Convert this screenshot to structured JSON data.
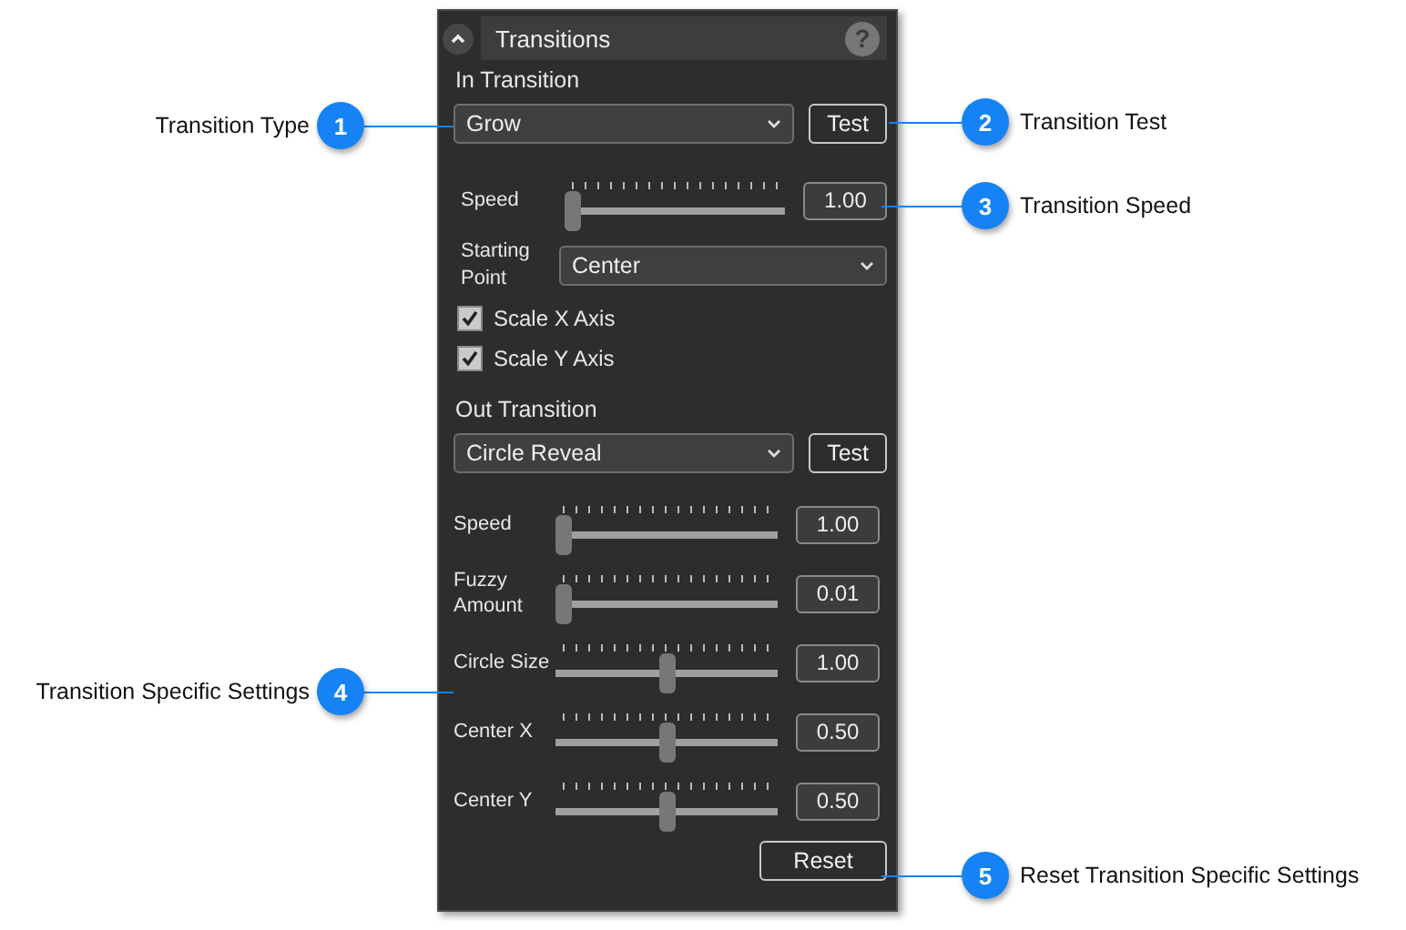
{
  "panel": {
    "title": "Transitions",
    "help": "?",
    "in_transition": {
      "heading": "In Transition",
      "type": "Grow",
      "test_button": "Test",
      "sliders": [
        {
          "label": "Speed",
          "level": 0,
          "reading": "1.00"
        }
      ],
      "starting_point": {
        "label": "Starting Point",
        "value": "Center"
      },
      "options": [
        {
          "label": "Scale X Axis",
          "checked": true
        },
        {
          "label": "Scale Y Axis",
          "checked": true
        }
      ]
    },
    "out_transition": {
      "heading": "Out Transition",
      "type": "Circle Reveal",
      "test_button": "Test",
      "sliders": [
        {
          "label": "Speed",
          "level": 0,
          "reading": "1.00"
        },
        {
          "label": "Fuzzy Amount",
          "level": 0,
          "reading": "0.01"
        },
        {
          "label": "Circle Size",
          "level": 0.5,
          "reading": "1.00"
        },
        {
          "label": "Center X",
          "level": 0.5,
          "reading": "0.50"
        },
        {
          "label": "Center Y",
          "level": 0.5,
          "reading": "0.50"
        }
      ]
    },
    "reset_button": "Reset"
  },
  "callouts": [
    {
      "number": "1",
      "label": "Transition Type"
    },
    {
      "number": "2",
      "label": "Transition Test"
    },
    {
      "number": "3",
      "label": "Transition Speed"
    },
    {
      "number": "4",
      "label": "Transition Specific Settings"
    },
    {
      "number": "5",
      "label": "Reset Transition Specific Settings"
    }
  ]
}
